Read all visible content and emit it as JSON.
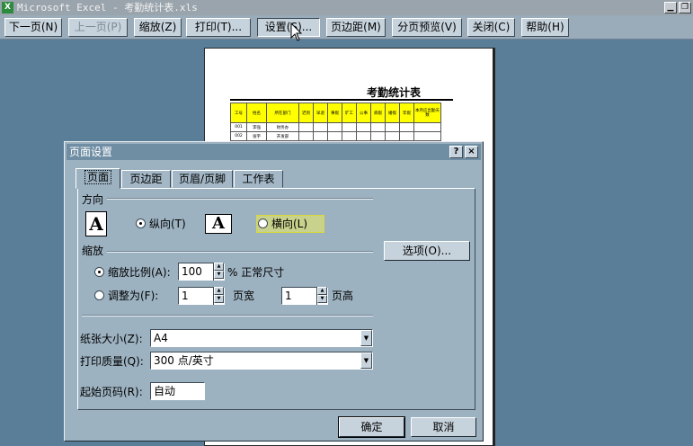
{
  "window": {
    "title": "Microsoft Excel - 考勤统计表.xls",
    "app_icon": "X"
  },
  "toolbar": {
    "next": "下一页(N)",
    "prev": "上一页(P)",
    "zoom": "缩放(Z)",
    "print": "打印(T)...",
    "setup": "设置(S)...",
    "margins": "页边距(M)",
    "page_break": "分页预览(V)",
    "close": "关闭(C)",
    "help": "帮助(H)"
  },
  "sheet": {
    "title": "考勤统计表",
    "headers": [
      "工号",
      "姓名",
      "所在部门",
      "迟到",
      "早退",
      "事假",
      "旷工",
      "公事",
      "病假",
      "婚假",
      "年假",
      "本月应出勤天数"
    ],
    "rows": [
      [
        "001",
        "李强",
        "财务办"
      ],
      [
        "002",
        "张宇",
        "开发部"
      ]
    ]
  },
  "dialog": {
    "title": "页面设置",
    "help_btn": "?",
    "close_btn": "×",
    "tabs": [
      "页面",
      "页边距",
      "页眉/页脚",
      "工作表"
    ],
    "orientation": {
      "label": "方向",
      "icon_letter": "A",
      "portrait": "纵向(T)",
      "landscape": "横向(L)"
    },
    "scaling": {
      "label": "缩放",
      "adjust_label": "缩放比例(A):",
      "adjust_value": "100",
      "adjust_suffix": "% 正常尺寸",
      "fit_label": "调整为(F):",
      "fit_wide_value": "1",
      "fit_wide_suffix": "页宽",
      "fit_tall_value": "1",
      "fit_tall_suffix": "页高"
    },
    "options_btn": "选项(O)...",
    "paper_size": {
      "label": "纸张大小(Z):",
      "value": "A4"
    },
    "print_quality": {
      "label": "打印质量(Q):",
      "value": "300 点/英寸"
    },
    "first_page": {
      "label": "起始页码(R):",
      "value": "自动"
    },
    "ok": "确定",
    "cancel": "取消"
  }
}
